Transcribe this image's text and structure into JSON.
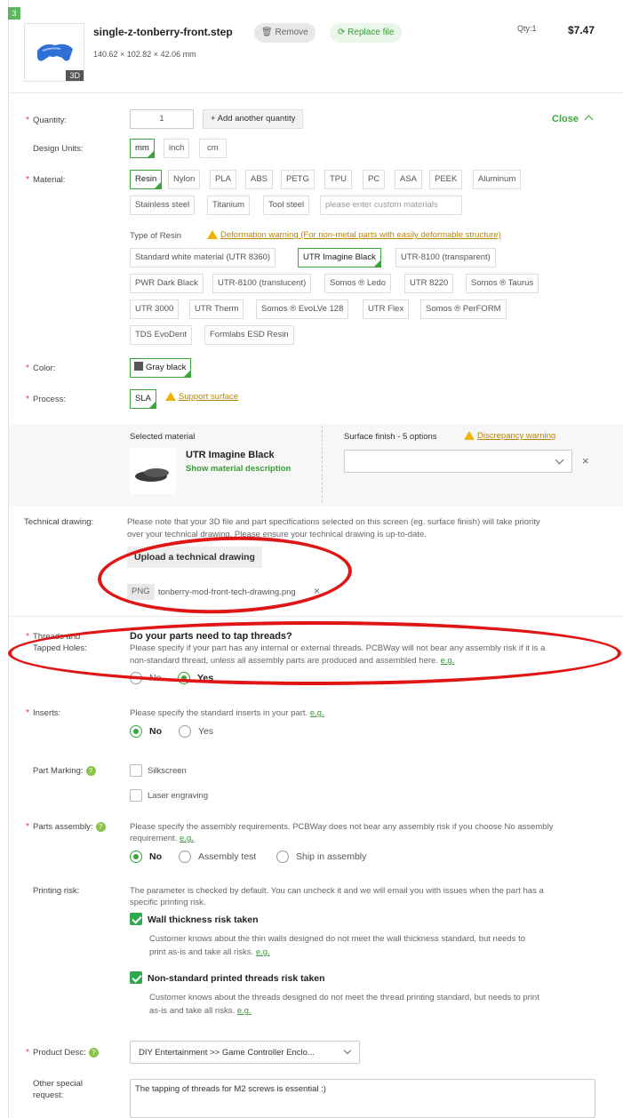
{
  "header": {
    "index": "3",
    "thumb_tag": "3D",
    "file_name": "single-z-tonberry-front.step",
    "dimensions": "140.62 × 102.82 × 42.06 mm",
    "remove_label": "Remove",
    "replace_label": "Replace file",
    "qty": "Qty:1",
    "price": "$7.47"
  },
  "quantity": {
    "label": "Quantity:",
    "value": "1",
    "add_label": "+ Add another quantity",
    "close_label": "Close"
  },
  "design_units": {
    "label": "Design Units:",
    "options": [
      "mm",
      "inch",
      "cm"
    ],
    "selected": "mm"
  },
  "material": {
    "label": "Material:",
    "options_row1": [
      "Resin",
      "Nylon",
      "PLA",
      "ABS",
      "PETG",
      "TPU",
      "PC",
      "ASA",
      "PEEK",
      "Aluminum"
    ],
    "options_row2": [
      "Stainless steel",
      "Titanium",
      "Tool steel"
    ],
    "custom_placeholder": "please enter custom materials",
    "selected": "Resin"
  },
  "resin": {
    "type_label": "Type of Resin",
    "warning": "Deformation warning (For non-metal parts with easily deformable structure)",
    "row1": [
      "Standard white material (UTR 8360)",
      "UTR Imagine Black",
      "UTR-8100 (transparent)"
    ],
    "row2": [
      "PWR Dark Black",
      "UTR-8100 (translucent)",
      "Somos ® Ledo",
      "UTR 8220",
      "Somos ® Taurus"
    ],
    "row3": [
      "UTR 3000",
      "UTR Therm",
      "Somos ® EvoLVe 128",
      "UTR Flex",
      "Somos ® PerFORM"
    ],
    "row4": [
      "TDS EvoDent",
      "Formlabs ESD Resin"
    ],
    "selected": "UTR Imagine Black"
  },
  "color": {
    "label": "Color:",
    "value": "Gray black",
    "swatch": "#555555"
  },
  "process": {
    "label": "Process:",
    "value": "SLA",
    "support_link": "Support surface"
  },
  "selected_material": {
    "title": "Selected material",
    "name": "UTR Imagine Black",
    "desc_link": "Show material description",
    "finish_label": "Surface finish - 5 options",
    "discrepancy": "Discrepancy warning"
  },
  "technical": {
    "label": "Technical drawing:",
    "note": "Please note that your 3D file and part specifications selected on this screen (eg. surface finish) will take priority",
    "note2": "over your technical drawing. Please ensure your technical drawing is up-to-date.",
    "upload_label": "Upload a technical drawing",
    "file_type": "PNG",
    "file_name": "tonberry-mod-front-tech-drawing.png"
  },
  "threads": {
    "label1": "Threads and",
    "label2": "Tapped Holes:",
    "question": "Do your parts need to tap threads?",
    "desc1": "Please specify if your part has any internal or external threads. PCBWay will not bear any assembly risk if it is a",
    "desc2": "non-standard thread, unless all assembly parts are produced and assembled here.",
    "eg": "e.g.",
    "no": "No",
    "yes": "Yes"
  },
  "inserts": {
    "label": "Inserts:",
    "desc": "Please specify the standard inserts in your part.",
    "eg": "e.g.",
    "no": "No",
    "yes": "Yes"
  },
  "marking": {
    "label": "Part Marking:",
    "silkscreen": "Silkscreen",
    "laser": "Laser engraving"
  },
  "assembly": {
    "label": "Parts assembly:",
    "desc1": "Please specify the assembly requirements. PCBWay does not bear any assembly risk if you choose No assembly",
    "desc2": "requirement.",
    "eg": "e.g.",
    "no": "No",
    "test": "Assembly test",
    "ship": "Ship in assembly"
  },
  "risk": {
    "label": "Printing risk:",
    "desc1": "The parameter is checked by default. You can uncheck it and we will email you with issues when the part has a",
    "desc2": "specific printing risk.",
    "wall_title": "Wall thickness risk taken",
    "wall_desc1": "Customer knows about the thin walls designed do not meet the wall thickness standard, but needs to",
    "wall_desc2": "print as-is and take all risks.",
    "thread_title": "Non-standard printed threads risk taken",
    "thread_desc1": "Customer knows about the threads designed do not meet the thread printing standard, but needs to print",
    "thread_desc2": "as-is and take all risks.",
    "eg": "e.g."
  },
  "product": {
    "label": "Product Desc:",
    "value": "DIY Entertainment >> Game Controller Enclo..."
  },
  "special": {
    "label1": "Other special",
    "label2": "request:",
    "value": "The tapping of threads for M2 screws is essential :)"
  },
  "colors": {
    "accent": "#3aa53a",
    "annotation": "#e01515",
    "required": "#e33333"
  }
}
